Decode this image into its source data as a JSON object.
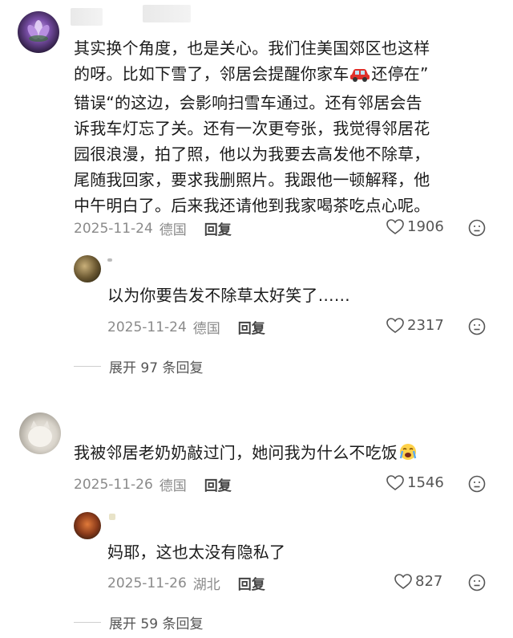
{
  "comments": [
    {
      "text_lines": [
        "其实换个角度，也是关心。我们住美国郊区也这样",
        "的呀。比如下雪了，邻居会提醒你家车",
        "错误“的这边，会影响扫雪车通过。还有邻居会告",
        "诉我车灯忘了关。还有一次更夸张，我觉得邻居花",
        "园很浪漫，拍了照，他以为我要去高发他不除草，",
        "尾随我回家，要求我删照片。我跟他一顿解释，他",
        "中午明白了。后来我还请他到我家喝茶吃点心呢。"
      ],
      "line2_suffix": "还停在”",
      "line2_emoji": "car-icon",
      "date": "2025-11-24",
      "location": "德国",
      "reply_label": "回复",
      "likes": "1906",
      "replies": [
        {
          "text": "以为你要告发不除草太好笑了……",
          "date": "2025-11-24",
          "location": "德国",
          "reply_label": "回复",
          "likes": "2317"
        }
      ],
      "expand_label": "展开 97 条回复"
    },
    {
      "text": "我被邻居老奶奶敲过门，她问我为什么不吃饭",
      "text_emoji": "crying-face-icon",
      "date": "2025-11-26",
      "location": "德国",
      "reply_label": "回复",
      "likes": "1546",
      "replies": [
        {
          "text": "妈耶，这也太没有隐私了",
          "date": "2025-11-26",
          "location": "湖北",
          "reply_label": "回复",
          "likes": "827"
        }
      ],
      "expand_label": "展开 59 条回复"
    }
  ],
  "colors": {
    "meta": "#8a8a8a",
    "body": "#1b1b1b"
  }
}
